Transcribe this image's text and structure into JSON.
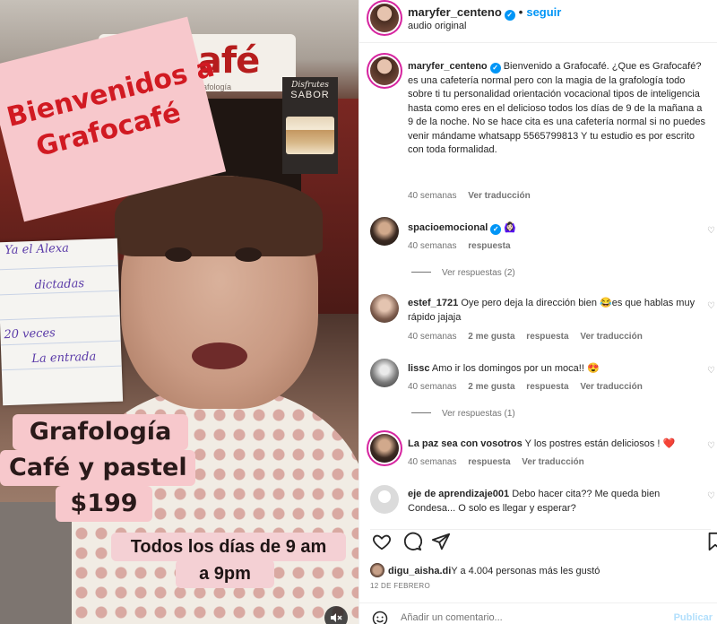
{
  "video": {
    "sign_text": "café",
    "sign_sub": "de la grafología",
    "welcome_line1": "Bienvenidos a",
    "welcome_line2": "Grafocafé",
    "poster_title": "Disfrutes",
    "poster_sub": "SABOR",
    "promo_line1": "Grafología",
    "promo_line2": "Café y pastel",
    "promo_line3": "$199",
    "hours_line1": "Todos los días de 9 am",
    "hours_line2": "a 9pm",
    "notepad_lines": [
      "Ya el Alexa",
      "dictadas",
      "20 veces",
      "La entrada"
    ],
    "mute_icon": "speaker-muted-icon"
  },
  "header": {
    "username": "maryfer_centeno",
    "follow_label": "seguir",
    "audio_label": "audio original"
  },
  "caption": {
    "username": "maryfer_centeno",
    "text": "Bienvenido a Grafocafé. ¿Que es Grafocafé? es una cafetería normal pero con la magia de la grafología todo sobre ti tu personalidad orientación vocacional tipos de inteligencia hasta como eres en el delicioso todos los días de 9 de la mañana a 9 de la noche. No se hace cita es una cafetería normal si no puedes venir mándame whatsapp 5565799813 Y tu estudio es por escrito con toda formalidad.",
    "time": "40 semanas",
    "translate": "Ver traducción"
  },
  "comments": [
    {
      "user": "spacioemocional",
      "text": "🙆🏻‍♀️",
      "time": "40 semanas",
      "likes": "",
      "reply": "respuesta",
      "translate": "",
      "view_replies": "Ver respuestas (2)"
    },
    {
      "user": "estef_1721",
      "text": "Oye pero deja la dirección bien 😂es que hablas muy rápido jajaja",
      "time": "40 semanas",
      "likes": "2 me gusta",
      "reply": "respuesta",
      "translate": "Ver traducción",
      "view_replies": ""
    },
    {
      "user": "lissc",
      "text": "Amo ir los domingos por un moca!! 😍",
      "time": "40 semanas",
      "likes": "2 me gusta",
      "reply": "respuesta",
      "translate": "Ver traducción",
      "view_replies": "Ver respuestas (1)"
    },
    {
      "user": "La paz sea con vosotros",
      "text": "Y los postres están deliciosos ! ❤️",
      "time": "40 semanas",
      "likes": "",
      "reply": "respuesta",
      "translate": "Ver traducción",
      "view_replies": ""
    },
    {
      "user": "eje de aprendizaje001",
      "text": "Debo hacer cita?? Me queda bien Condesa... O solo es llegar y esperar?",
      "time": "",
      "likes": "",
      "reply": "",
      "translate": "",
      "view_replies": ""
    }
  ],
  "likes": {
    "user": "digu_aisha.di",
    "rest": "Y a 4.004 personas más les gustó"
  },
  "date": "12 DE FEBRERO",
  "add_comment": {
    "placeholder": "Añadir un comentario...",
    "publish": "Publicar"
  },
  "icons": {
    "like": "heart-icon",
    "comment": "comment-icon",
    "share": "send-icon",
    "save": "bookmark-icon",
    "emoji": "emoji-icon"
  }
}
